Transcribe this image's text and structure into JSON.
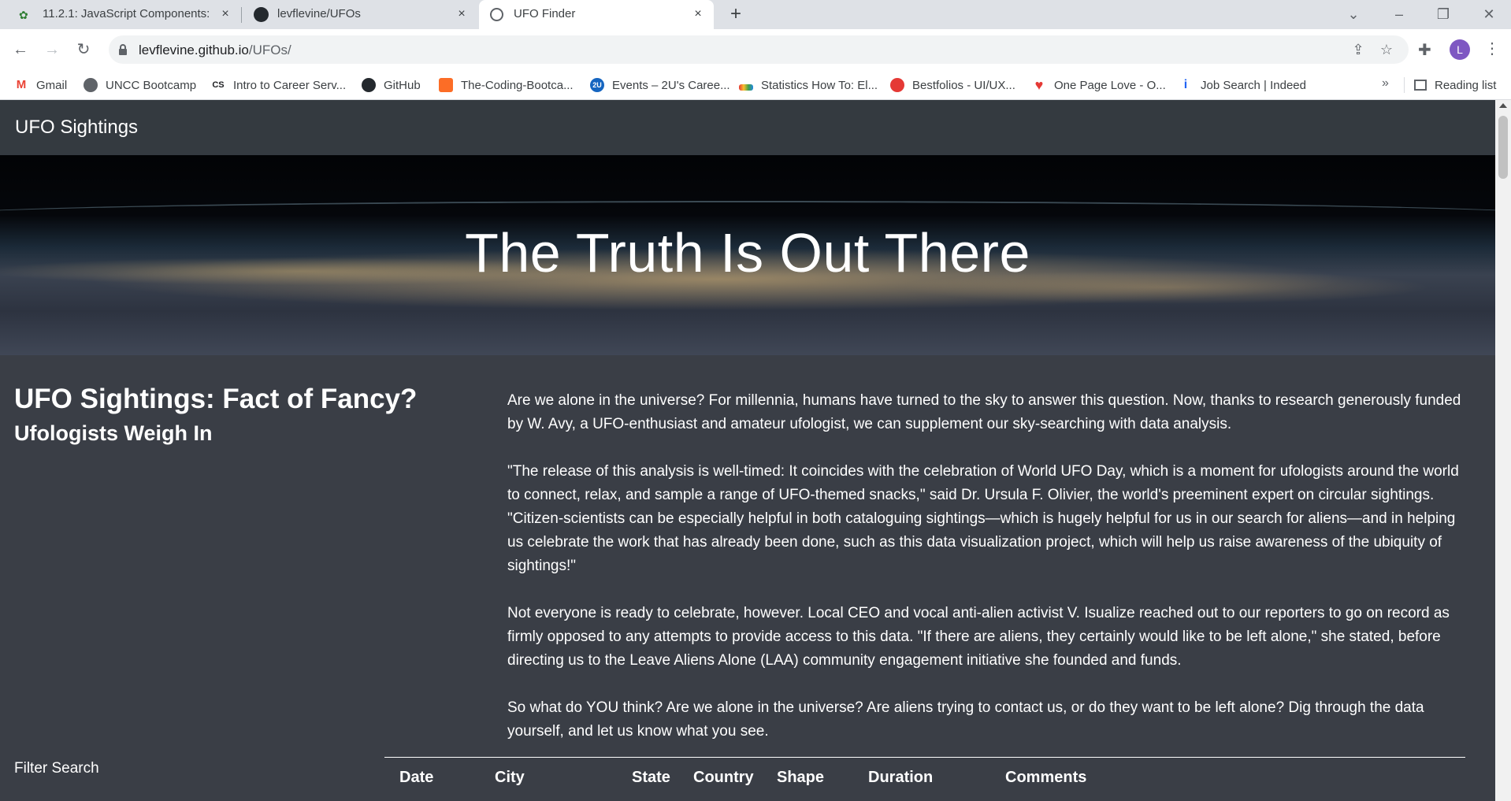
{
  "browser": {
    "tabs": [
      {
        "title": "11.2.1: JavaScript Components: B",
        "active": false
      },
      {
        "title": "levflevine/UFOs",
        "active": false
      },
      {
        "title": "UFO Finder",
        "active": true
      }
    ],
    "url_host": "levflevine.github.io",
    "url_path": "/UFOs/",
    "avatar_letter": "L",
    "bookmarks": [
      {
        "label": "Gmail",
        "icon": "gmail-icon"
      },
      {
        "label": "UNCC Bootcamp",
        "icon": "globe-icon"
      },
      {
        "label": "Intro to Career Serv...",
        "icon": "cs-icon"
      },
      {
        "label": "GitHub",
        "icon": "github-icon"
      },
      {
        "label": "The-Coding-Bootca...",
        "icon": "gitlab-icon"
      },
      {
        "label": "Events – 2U's Caree...",
        "icon": "2u-icon"
      },
      {
        "label": "Statistics How To: El...",
        "icon": "chart-icon"
      },
      {
        "label": "Bestfolios - UI/UX...",
        "icon": "bestfolios-icon"
      },
      {
        "label": "One Page Love - O...",
        "icon": "heart-icon"
      },
      {
        "label": "Job Search | Indeed",
        "icon": "indeed-icon"
      }
    ],
    "reading_list": "Reading list"
  },
  "site": {
    "brand": "UFO Sightings",
    "hero_title": "The Truth Is Out There",
    "article": {
      "heading": "UFO Sightings: Fact of Fancy?",
      "subheading": "Ufologists Weigh In",
      "paragraphs": [
        "Are we alone in the universe? For millennia, humans have turned to the sky to answer this question. Now, thanks to research generously funded by W. Avy, a UFO-enthusiast and amateur ufologist, we can supplement our sky-searching with data analysis.",
        "\"The release of this analysis is well-timed: It coincides with the celebration of World UFO Day, which is a moment for ufologists around the world to connect, relax, and sample a range of UFO-themed snacks,\" said Dr. Ursula F. Olivier, the world's preeminent expert on circular sightings. \"Citizen-scientists can be especially helpful in both cataloguing sightings—which is hugely helpful for us in our search for aliens—and in helping us celebrate the work that has already been done, such as this data visualization project, which will help us raise awareness of the ubiquity of sightings!\"",
        "Not everyone is ready to celebrate, however. Local CEO and vocal anti-alien activist V. Isualize reached out to our reporters to go on record as firmly opposed to any attempts to provide access to this data. \"If there are aliens, they certainly would like to be left alone,\" she stated, before directing us to the Leave Aliens Alone (LAA) community engagement initiative she founded and funds.",
        "So what do YOU think? Are we alone in the universe? Are aliens trying to contact us, or do they want to be left alone? Dig through the data yourself, and let us know what you see."
      ]
    },
    "filter_label": "Filter Search",
    "table_headers": [
      "Date",
      "City",
      "State",
      "Country",
      "Shape",
      "Duration",
      "Comments"
    ]
  }
}
